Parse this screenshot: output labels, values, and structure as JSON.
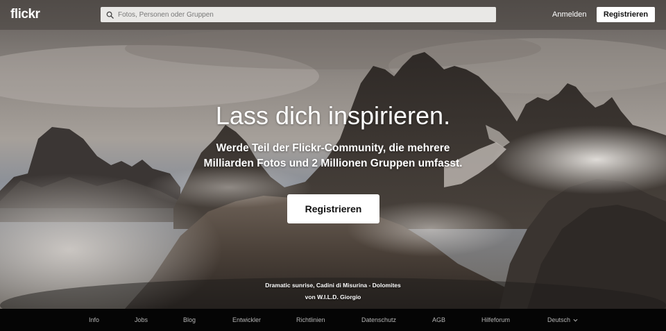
{
  "header": {
    "logo": "flickr",
    "search": {
      "placeholder": "Fotos, Personen oder Gruppen",
      "value": ""
    },
    "login_label": "Anmelden",
    "signup_label": "Registrieren"
  },
  "hero": {
    "title": "Lass dich inspirieren.",
    "subtitle": "Werde Teil der Flickr-Community, die mehrere Milliarden Fotos und 2 Millionen Gruppen umfasst.",
    "cta_label": "Registrieren",
    "photo_title": "Dramatic sunrise, Cadini di Misurina - Dolomites",
    "photo_by_prefix": "von ",
    "photo_author": "W.I.L.D. Giorgio"
  },
  "footer": {
    "links": [
      "Info",
      "Jobs",
      "Blog",
      "Entwickler",
      "Richtlinien",
      "Datenschutz",
      "AGB",
      "Hilfeforum"
    ],
    "language": "Deutsch"
  },
  "colors": {
    "header_bg": "#46403c",
    "footer_bg": "#050505",
    "button_bg": "#ffffff",
    "text_light": "#ffffff",
    "footer_text": "#b5b5b5"
  },
  "icons": {
    "search": "search-icon",
    "language_dropdown": "chevron-down-icon"
  }
}
